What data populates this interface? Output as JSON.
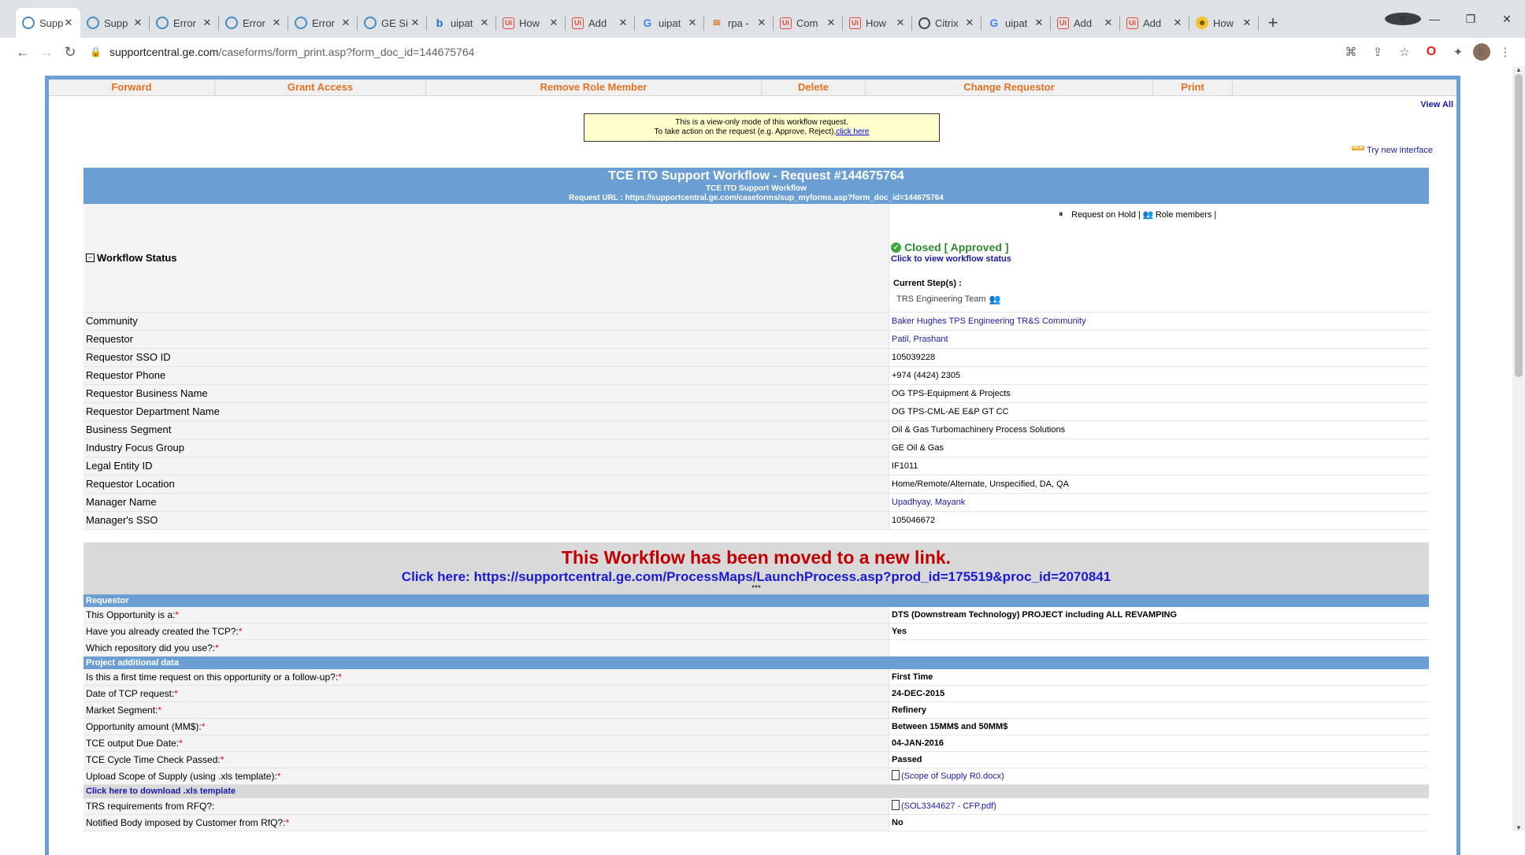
{
  "browser": {
    "tabs": [
      {
        "title": "Supp",
        "icon": "ge-icon",
        "active": true
      },
      {
        "title": "Supp",
        "icon": "ge-icon"
      },
      {
        "title": "Error",
        "icon": "ge-icon"
      },
      {
        "title": "Error",
        "icon": "ge-icon"
      },
      {
        "title": "Error",
        "icon": "ge-icon"
      },
      {
        "title": "GE Si",
        "icon": "ge-icon"
      },
      {
        "title": "uipat",
        "icon": "bing-icon"
      },
      {
        "title": "How",
        "icon": "uipath-icon"
      },
      {
        "title": "Add",
        "icon": "uipath-icon"
      },
      {
        "title": "uipat",
        "icon": "google-icon"
      },
      {
        "title": "rpa -",
        "icon": "stackoverflow-icon"
      },
      {
        "title": "Com",
        "icon": "uipath-icon"
      },
      {
        "title": "How",
        "icon": "uipath-icon"
      },
      {
        "title": "Citrix",
        "icon": "citrix-icon"
      },
      {
        "title": "uipat",
        "icon": "google-icon"
      },
      {
        "title": "Add",
        "icon": "uipath-icon"
      },
      {
        "title": "Add",
        "icon": "uipath-icon"
      },
      {
        "title": "How",
        "icon": "howtogeek-icon"
      }
    ],
    "url_host": "supportcentral.ge.com",
    "url_path": "/caseforms/form_print.asp?form_doc_id=144675764",
    "profile_initial": "E"
  },
  "actions": [
    {
      "label": "Forward",
      "width": 210
    },
    {
      "label": "Grant Access",
      "width": 267
    },
    {
      "label": "Remove Role Member",
      "width": 425
    },
    {
      "label": "Delete",
      "width": 131
    },
    {
      "label": "Change Requestor",
      "width": 364
    },
    {
      "label": "Print",
      "width": 100
    }
  ],
  "view_all": "View All",
  "notice": {
    "line1": "This is a view-only mode of this workflow request.",
    "line2_prefix": "To take action on the request (e.g. Approve, Reject),",
    "link": "click here"
  },
  "try_new": {
    "badge": "NEW",
    "label": "Try new interface"
  },
  "request": {
    "title": "TCE ITO Support Workflow - Request #144675764",
    "subtitle": "TCE ITO Support Workflow",
    "url_line": "Request URL : https://supportcentral.ge.com/caseforms/sup_myforms.asp?form_doc_id=144675764"
  },
  "workflow_status": {
    "label": "Workflow Status",
    "on_hold": "Request on Hold |",
    "role_members": "Role members |",
    "status": "Closed [ Approved ]",
    "view_link": "Click to view workflow status",
    "current_steps_label": "Current Step(s) :",
    "current_step": "TRS Engineering Team"
  },
  "fields": [
    {
      "label": "Community",
      "value": "Baker Hughes TPS Engineering TR&S Community",
      "link": true
    },
    {
      "label": "Requestor",
      "value": "Patil, Prashant",
      "link": true
    },
    {
      "label": "Requestor SSO ID",
      "value": "105039228"
    },
    {
      "label": "Requestor Phone",
      "value": "+974 (4424) 2305"
    },
    {
      "label": "Requestor Business Name",
      "value": "OG TPS-Equipment & Projects"
    },
    {
      "label": "Requestor Department Name",
      "value": "OG TPS-CML-AE E&P GT CC"
    },
    {
      "label": "Business Segment",
      "value": "Oil & Gas Turbomachinery Process Solutions"
    },
    {
      "label": "Industry Focus Group",
      "value": "GE Oil & Gas"
    },
    {
      "label": "Legal Entity ID",
      "value": "IF1011"
    },
    {
      "label": "Requestor Location",
      "value": "Home/Remote/Alternate, Unspecified, DA, QA"
    },
    {
      "label": "Manager Name",
      "value": "Upadhyay, Mayank",
      "link": true
    },
    {
      "label": "Manager's SSO",
      "value": "105046672"
    }
  ],
  "moved": {
    "headline": "This Workflow has been moved to a new link.",
    "link": "Click here: https://supportcentral.ge.com/ProcessMaps/LaunchProcess.asp?prod_id=175519&proc_id=2070841",
    "stars": "***"
  },
  "sections": {
    "requestor": "Requestor",
    "project": "Project additional data",
    "download": "Click here to download .xls template"
  },
  "requestor_fields": [
    {
      "label": "This Opportunity is a:",
      "value": "DTS (Downstream Technology) PROJECT including ALL REVAMPING"
    },
    {
      "label": "Have you already created the TCP?:",
      "value": "Yes"
    },
    {
      "label": "Which repository did you use?:",
      "value": ""
    }
  ],
  "project_fields": [
    {
      "label": "Is this a first time request on this opportunity or a follow-up?:",
      "value": "First Time"
    },
    {
      "label": "Date of TCP request:",
      "value": "24-DEC-2015"
    },
    {
      "label": "Market Segment:",
      "value": "Refinery"
    },
    {
      "label": "Opportunity amount (MM$):",
      "value": "Between 15MM$ and 50MM$"
    },
    {
      "label": "TCE output Due Date:",
      "value": "04-JAN-2016"
    },
    {
      "label": "TCE Cycle Time Check Passed:",
      "value": "Passed"
    },
    {
      "label": "Upload Scope of Supply (using .xls template):",
      "value": "(Scope of Supply R0.docx)",
      "file": true
    }
  ],
  "extra_fields": [
    {
      "label": "TRS requirements from RFQ?:",
      "value": "(SOL3344627 - CFP.pdf)",
      "file": true,
      "required": false
    },
    {
      "label": "Notified Body imposed by Customer from RfQ?:",
      "value": "No",
      "required": true
    }
  ],
  "required_mark": "*"
}
